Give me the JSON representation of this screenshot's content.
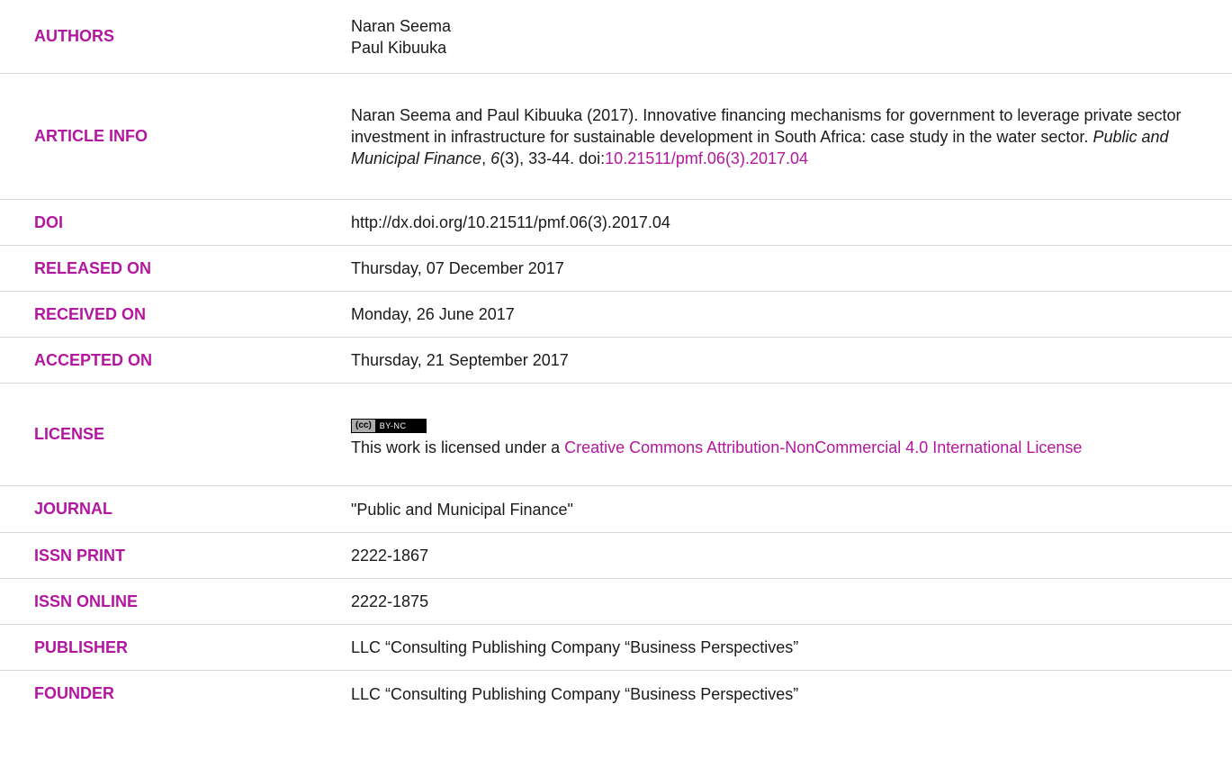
{
  "labels": {
    "authors": "AUTHORS",
    "article_info": "ARTICLE INFO",
    "doi": "DOI",
    "released_on": "RELEASED ON",
    "received_on": "RECEIVED ON",
    "accepted_on": "ACCEPTED ON",
    "license": "LICENSE",
    "journal": "JOURNAL",
    "issn_print": "ISSN PRINT",
    "issn_online": "ISSN ONLINE",
    "publisher": "PUBLISHER",
    "founder": "FOUNDER"
  },
  "authors": [
    "Naran Seema",
    "Paul Kibuuka"
  ],
  "article_info": {
    "citation_start": "Naran Seema and Paul Kibuuka (2017). Innovative financing mechanisms for government to leverage private sector investment in infrastructure for sustainable development in South Africa: case study in the water sector. ",
    "journal_italic": "Public and Municipal Finance",
    "comma": ", ",
    "volume_italic": "6",
    "issue_pages": "(3), 33-44. doi:",
    "doi_link": "10.21511/pmf.06(3).2017.04"
  },
  "doi": "http://dx.doi.org/10.21511/pmf.06(3).2017.04",
  "released_on": "Thursday, 07 December 2017",
  "received_on": "Monday, 26 June 2017",
  "accepted_on": "Thursday, 21 September 2017",
  "license": {
    "badge_cc": "(cc)",
    "badge_by": "BY-NC",
    "text": "This work is licensed under a ",
    "link": "Creative Commons Attribution-NonCommercial 4.0 International License"
  },
  "journal": "\"Public and Municipal Finance\"",
  "issn_print": "2222-1867",
  "issn_online": "2222-1875",
  "publisher": "LLC “Consulting Publishing Company “Business Perspectives”",
  "founder": "LLC “Consulting Publishing Company “Business Perspectives”",
  "colors": {
    "accent": "#b4179f",
    "divider": "#d9d9d9",
    "text": "#1a1a1a"
  }
}
